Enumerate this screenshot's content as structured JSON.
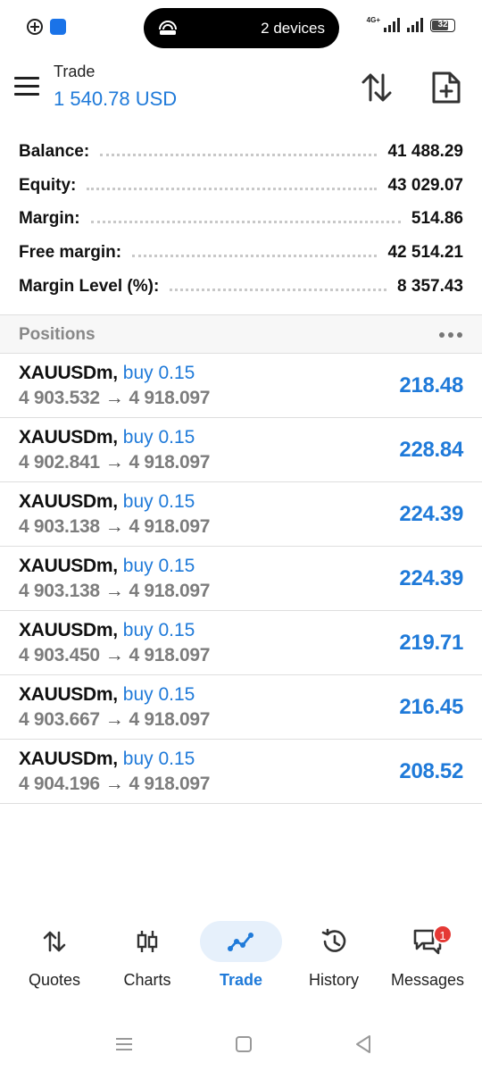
{
  "status_bar": {
    "cast_label": "2 devices",
    "network": "4G+",
    "battery_level": "32"
  },
  "header": {
    "title": "Trade",
    "value": "1 540.78 USD"
  },
  "account": [
    {
      "label": "Balance:",
      "value": "41 488.29"
    },
    {
      "label": "Equity:",
      "value": "43 029.07"
    },
    {
      "label": "Margin:",
      "value": "514.86"
    },
    {
      "label": "Free margin:",
      "value": "42 514.21"
    },
    {
      "label": "Margin Level (%):",
      "value": "8 357.43"
    }
  ],
  "positions": {
    "title": "Positions",
    "items": [
      {
        "symbol": "XAUUSDm,",
        "side": "buy 0.15",
        "open": "4 903.532",
        "arrow": "→",
        "current": "4 918.097",
        "profit": "218.48"
      },
      {
        "symbol": "XAUUSDm,",
        "side": "buy 0.15",
        "open": "4 902.841",
        "arrow": "→",
        "current": "4 918.097",
        "profit": "228.84"
      },
      {
        "symbol": "XAUUSDm,",
        "side": "buy 0.15",
        "open": "4 903.138",
        "arrow": "→",
        "current": "4 918.097",
        "profit": "224.39"
      },
      {
        "symbol": "XAUUSDm,",
        "side": "buy 0.15",
        "open": "4 903.138",
        "arrow": "→",
        "current": "4 918.097",
        "profit": "224.39"
      },
      {
        "symbol": "XAUUSDm,",
        "side": "buy 0.15",
        "open": "4 903.450",
        "arrow": "→",
        "current": "4 918.097",
        "profit": "219.71"
      },
      {
        "symbol": "XAUUSDm,",
        "side": "buy 0.15",
        "open": "4 903.667",
        "arrow": "→",
        "current": "4 918.097",
        "profit": "216.45"
      },
      {
        "symbol": "XAUUSDm,",
        "side": "buy 0.15",
        "open": "4 904.196",
        "arrow": "→",
        "current": "4 918.097",
        "profit": "208.52"
      }
    ]
  },
  "nav": {
    "items": [
      {
        "label": "Quotes",
        "icon": "quotes-icon"
      },
      {
        "label": "Charts",
        "icon": "charts-icon"
      },
      {
        "label": "Trade",
        "icon": "trade-icon",
        "active": true
      },
      {
        "label": "History",
        "icon": "history-icon"
      },
      {
        "label": "Messages",
        "icon": "messages-icon",
        "badge": "1"
      }
    ]
  },
  "colors": {
    "accent": "#1f7ad9",
    "badge": "#e53935",
    "muted": "#7d7d7d"
  }
}
